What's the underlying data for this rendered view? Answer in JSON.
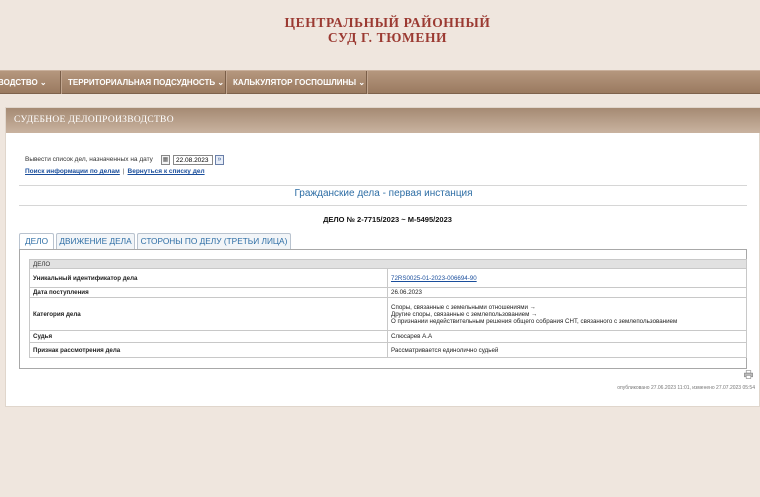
{
  "court": {
    "title_line1": "ЦЕНТРАЛЬНЫЙ РАЙОННЫЙ",
    "title_line2": "СУД Г. ТЮМЕНИ"
  },
  "nav": {
    "items": [
      {
        "label": "ВОДСТВО ⌄"
      },
      {
        "label": "ТЕРРИТОРИАЛЬНАЯ ПОДСУДНОСТЬ ⌄"
      },
      {
        "label": "КАЛЬКУЛЯТОР ГОСПОШЛИНЫ ⌄"
      }
    ]
  },
  "panel": {
    "title": "СУДЕБНОЕ ДЕЛОПРОИЗВОДСТВО"
  },
  "date_filter": {
    "label": "Вывести список дел, назначенных на дату",
    "value": "22.08.2023",
    "calendar_icon": "calendar-icon",
    "go_icon": "double-chevron-right-icon"
  },
  "links": {
    "search": "Поиск информации по делам",
    "separator": "|",
    "back": "Вернуться к списку дел"
  },
  "section_title": "Гражданские дела - первая инстанция",
  "case_number": "ДЕЛО № 2-7715/2023 ~ М-5495/2023",
  "tabs": [
    {
      "label": "ДЕЛО",
      "active": true
    },
    {
      "label": "ДВИЖЕНИЕ ДЕЛА",
      "active": false
    },
    {
      "label": "СТОРОНЫ ПО ДЕЛУ (ТРЕТЬИ ЛИЦА)",
      "active": false
    }
  ],
  "case_table": {
    "group_header": "ДЕЛО",
    "rows": [
      {
        "label": "Уникальный идентификатор дела",
        "value": "72RS0025-01-2023-006694-90"
      },
      {
        "label": "Дата поступления",
        "value": "26.06.2023"
      },
      {
        "label": "Категория дела",
        "value_lines": [
          "Споры, связанные с земельными отношениями →",
          "Другие споры, связанные с землепользованием →",
          "О признании недействительным решения общего собрания СНТ, связанного с землепользованием"
        ]
      },
      {
        "label": "Судья",
        "value": "Слюсарев А.А"
      },
      {
        "label": "Признак рассмотрения дела",
        "value": "Рассматривается единолично судьей"
      }
    ]
  },
  "footer": {
    "print_icon": "printer-icon",
    "published": "опубликовано 27.06.2023 11:01, изменено 27.07.2023 05:54"
  }
}
